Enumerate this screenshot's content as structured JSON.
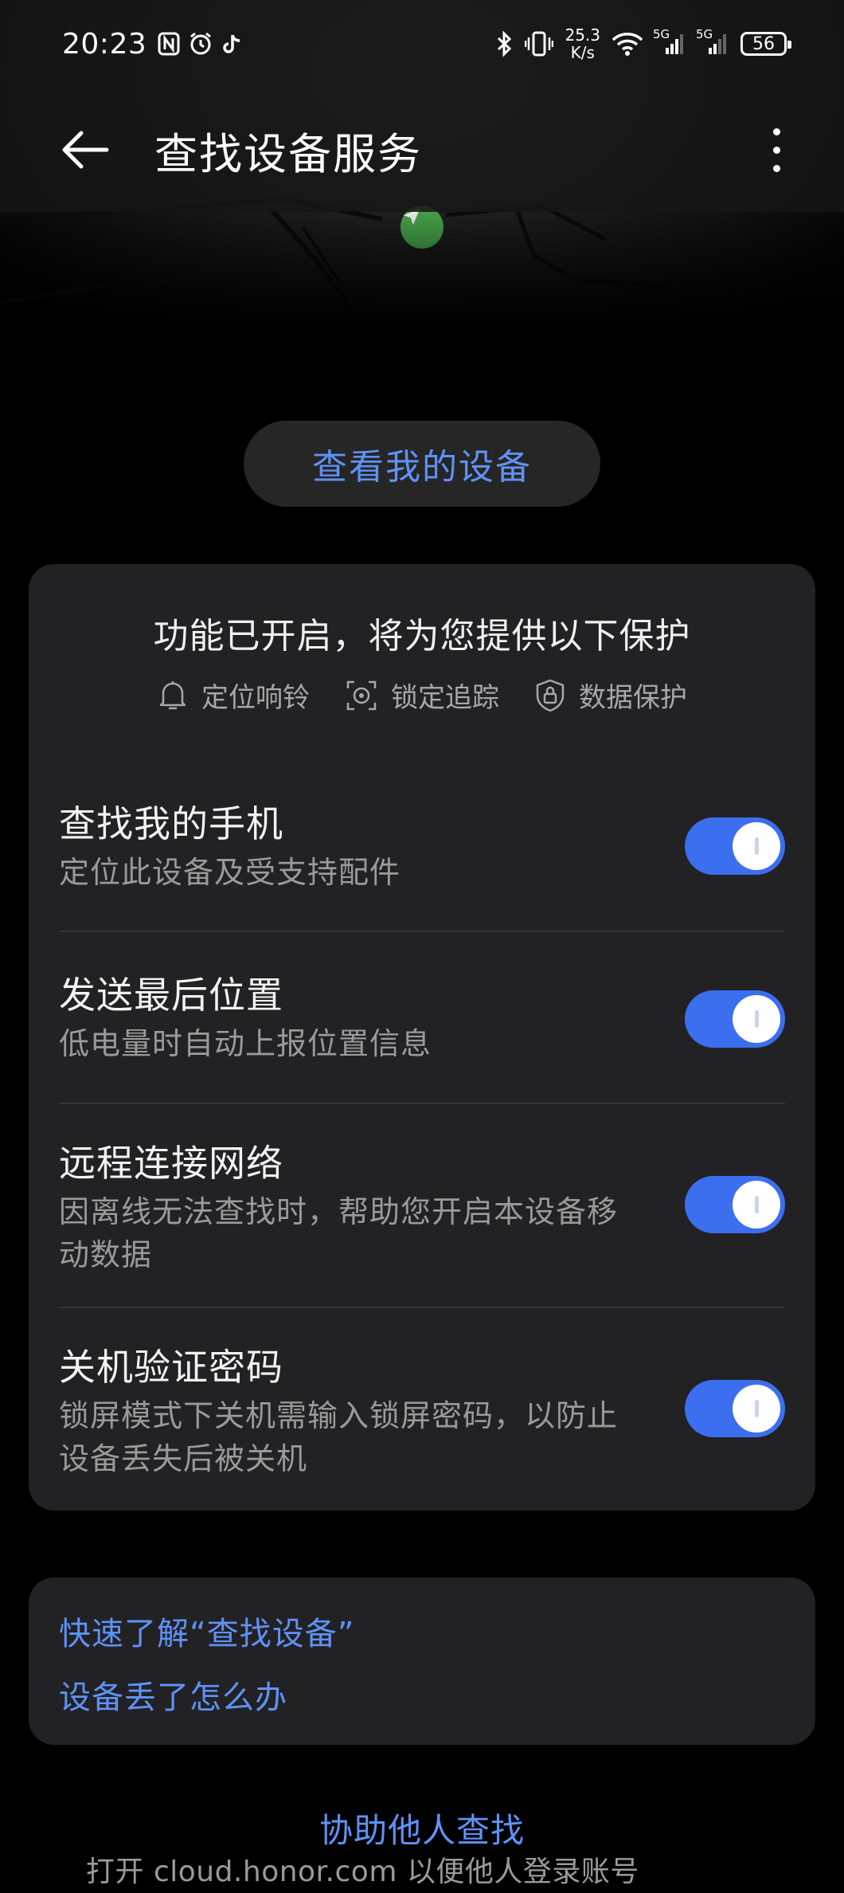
{
  "status_bar": {
    "time": "20:23",
    "net_speed_value": "25.3",
    "net_speed_unit": "K/s",
    "battery": "56",
    "signal_1_label": "5G",
    "signal_2_label": "5G"
  },
  "header": {
    "title": "查找设备服务"
  },
  "view_device_button": "查看我的设备",
  "protection": {
    "heading": "功能已开启，将为您提供以下保护",
    "features": [
      "定位响铃",
      "锁定追踪",
      "数据保护"
    ]
  },
  "settings": [
    {
      "title": "查找我的手机",
      "desc": "定位此设备及受支持配件",
      "enabled": true
    },
    {
      "title": "发送最后位置",
      "desc": "低电量时自动上报位置信息",
      "enabled": true
    },
    {
      "title": "远程连接网络",
      "desc": "因离线无法查找时，帮助您开启本设备移动数据",
      "enabled": true
    },
    {
      "title": "关机验证密码",
      "desc": "锁屏模式下关机需输入锁屏密码，以防止设备丢失后被关机",
      "enabled": true
    }
  ],
  "links": {
    "learn": "快速了解“查找设备”",
    "lost": "设备丢了怎么办"
  },
  "assist_link": "协助他人查找",
  "footer_note": "打开 cloud.honor.com 以便他人登录账号",
  "colors": {
    "accent": "#5f92f7",
    "toggle_on": "#3c6ef0",
    "card_bg": "#222224",
    "location_marker": "#4caf50"
  }
}
